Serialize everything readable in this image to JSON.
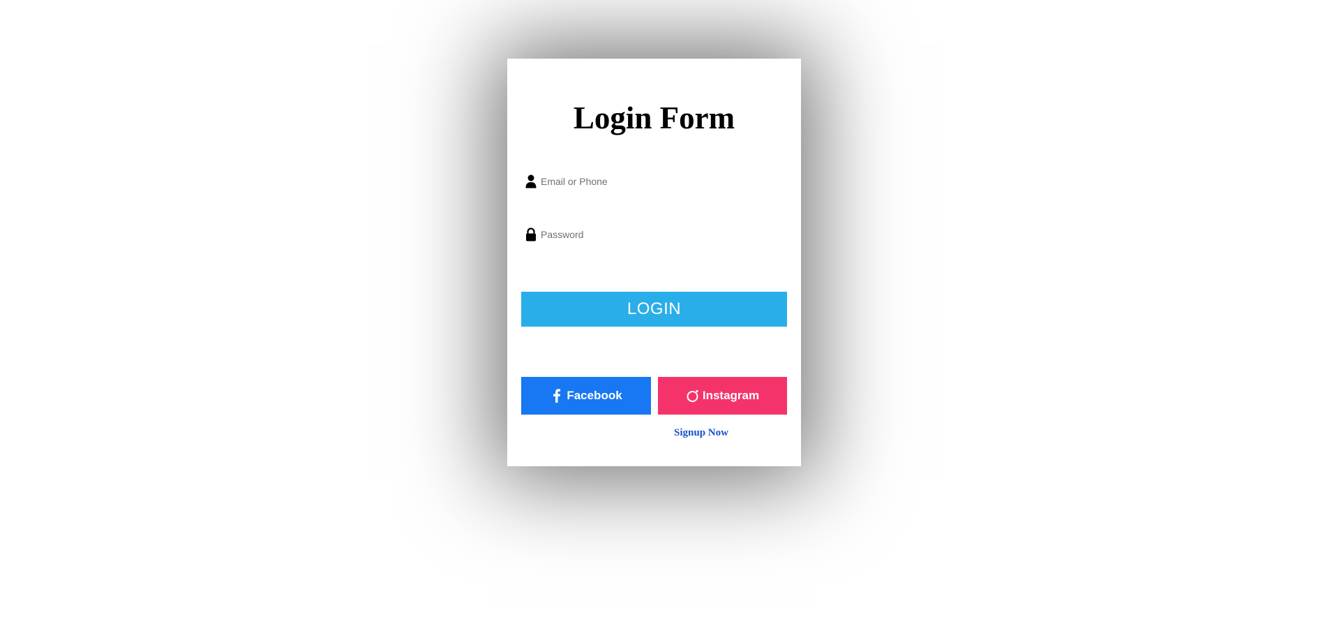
{
  "form": {
    "title": "Login Form",
    "email": {
      "placeholder": "Email or Phone",
      "value": "",
      "icon": "user-icon"
    },
    "password": {
      "placeholder": "Password",
      "value": "",
      "icon": "lock-icon"
    },
    "login_label": "LOGIN",
    "social": {
      "facebook_label": "Facebook",
      "facebook_icon": "facebook-icon",
      "instagram_label": "Instagram",
      "instagram_icon": "instagram-icon"
    },
    "signup_label": "Signup Now"
  },
  "colors": {
    "login_button": "#29aee9",
    "facebook_button": "#1877f2",
    "instagram_button": "#f5336b",
    "signup_link": "#1652c9"
  }
}
